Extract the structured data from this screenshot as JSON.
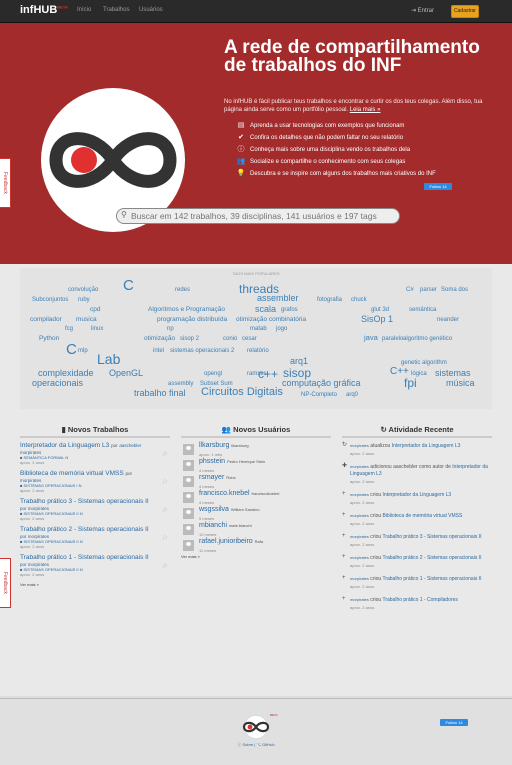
{
  "nav": {
    "brand": "infHUB",
    "brand_sup": "BETA",
    "links": [
      "Início",
      "Trabalhos",
      "Usuários"
    ],
    "login": "Entrar",
    "signup": "Cadastrar"
  },
  "hero": {
    "title": "A rede de compartilhamento de trabalhos do INF",
    "description": "No infHUB é fácil publicar teus trabalhos e encontrar e curtir os dos teus colegas. Além disso, tua página ainda serve como um portfólio pessoal.",
    "read_more": "Leia mais »",
    "features": [
      {
        "icon": "book-icon",
        "text": "Aprenda a usar tecnologias com exemplos que funcionam"
      },
      {
        "icon": "check-icon",
        "text": "Confira os detalhes que não podem faltar no seu relatório"
      },
      {
        "icon": "info-icon",
        "text": "Conheça mais sobre uma disciplina vendo os trabalhos dela"
      },
      {
        "icon": "users-icon",
        "text": "Socialize e compartilhe o conhecimento com seus colegas"
      },
      {
        "icon": "lightbulb-icon",
        "text": "Descubra e se inspire com alguns dos trabalhos mais criativos do INF"
      }
    ],
    "twitter": "Follow 14",
    "search_placeholder": "Buscar em 142 trabalhos, 39 disciplinas, 141 usuários e 197 tags"
  },
  "feedback": "Feedback",
  "tags_title": "TAGS MAIS POPULARES",
  "tags": [
    "C",
    "threads",
    "convolução",
    "redes",
    "C#",
    "parser",
    "Soma dos",
    "Subconjuntos",
    "ruby",
    "assembler",
    "fotografia",
    "chuck",
    "scala",
    "grafos",
    "SisOp 1",
    "glut 3d",
    "semântica",
    "compilador",
    "musica",
    "cpd",
    "Algoritmos e Programação",
    "programação distribuída",
    "otimização combinatória",
    "neander",
    "Python",
    "fcg",
    "linux",
    "np",
    "matab",
    "jogo",
    "otimização",
    "sisop 2",
    "conio",
    "cesar",
    "java",
    "paralelo",
    "algoritmo genético",
    "C",
    "Lab",
    "mlp",
    "intel",
    "sistemas operacionais 2",
    "relatório",
    "arq1",
    "C++",
    "genetic algorithm",
    "complexidade",
    "OpenGL",
    "opengl",
    "ramses",
    "c++",
    "sisop",
    "lógica",
    "sistemas",
    "operacionais",
    "assembly",
    "Subset Sum",
    "computação gráfica",
    "fpi",
    "música",
    "trabalho final",
    "Circuitos Digitais",
    "NP-Completo",
    "arq0"
  ],
  "columns": {
    "works_title": "Novos Trabalhos",
    "users_title": "Novos Usuários",
    "activity_title": "Atividade Recente",
    "by": "por",
    "works": [
      {
        "title": "Interpretador da Linguagem L3",
        "author": "aaschebler",
        "author2": "morpirates",
        "discipline": "SEMÂNTICA FORMAL N",
        "time": "aprox. 2 anos"
      },
      {
        "title": "Biblioteca de memória virtual VMSS",
        "author": "morpirates",
        "author2": "",
        "discipline": "SISTEMAS OPERACIONAIS I N",
        "time": "aprox. 2 anos"
      },
      {
        "title": "Trabalho prático 3 - Sistemas operacionais II",
        "author": "morpirates",
        "author2": "",
        "discipline": "SISTEMAS OPERACIONAIS II N",
        "time": "aprox. 2 anos"
      },
      {
        "title": "Trabalho prático 2 - Sistemas operacionais II",
        "author": "morpirates",
        "author2": "",
        "discipline": "SISTEMAS OPERACIONAIS II N",
        "time": "aprox. 2 anos"
      },
      {
        "title": "Trabalho prático 1 - Sistemas operacionais II",
        "author": "morpirates",
        "author2": "",
        "discipline": "SISTEMAS OPERACIONAIS II N",
        "time": "aprox. 2 anos"
      }
    ],
    "works_more": "Ver mais »",
    "users": [
      {
        "username": "llkarsburg",
        "name": "llkarsburg",
        "time": "aprox. 1 mês"
      },
      {
        "username": "phsstein",
        "name": "Pedro Henrique Stein",
        "time": "4 meses"
      },
      {
        "username": "rsmayer",
        "name": "Robs",
        "time": "4 meses"
      },
      {
        "username": "francisco.knebel",
        "name": "franciscoknebel",
        "time": "4 meses"
      },
      {
        "username": "wsgssilva",
        "name": "William Sandino",
        "time": "5 meses"
      },
      {
        "username": "mbianchi",
        "name": "mate.bianchi",
        "time": "10 meses"
      },
      {
        "username": "rafael.junioribeiro",
        "name": "Rafa",
        "time": "11 meses"
      }
    ],
    "users_more": "Ver mais »",
    "activity": [
      {
        "icon": "refresh-icon",
        "user": "morpirates",
        "text": "atualizou",
        "target": "Interpretador da Linguagem L3",
        "time": "aprox. 2 anos"
      },
      {
        "icon": "user-plus-icon",
        "user": "morpirates",
        "text": "adicionou aaschebler como autor de",
        "target": "Interpretador da Linguagem L3",
        "time": "aprox. 2 anos"
      },
      {
        "icon": "plus-icon",
        "user": "morpirates",
        "text": "criou",
        "target": "Interpretador da Linguagem L3",
        "time": "aprox. 2 anos"
      },
      {
        "icon": "plus-icon",
        "user": "morpirates",
        "text": "criou",
        "target": "Biblioteca de memória virtual VMSS",
        "time": "aprox. 2 anos"
      },
      {
        "icon": "plus-icon",
        "user": "morpirates",
        "text": "criou",
        "target": "Trabalho prático 3 - Sistemas operacionais II",
        "time": "aprox. 2 anos"
      },
      {
        "icon": "plus-icon",
        "user": "morpirates",
        "text": "criou",
        "target": "Trabalho prático 2 - Sistemas operacionais II",
        "time": "aprox. 2 anos"
      },
      {
        "icon": "plus-icon",
        "user": "morpirates",
        "text": "criou",
        "target": "Trabalho prático 1 - Sistemas operacionais II",
        "time": "aprox. 2 anos"
      },
      {
        "icon": "plus-icon",
        "user": "morpirates",
        "text": "criou",
        "target": "Trabalho prático 1 - Compiladores",
        "time": "aprox. 2 anos"
      }
    ]
  },
  "footer": {
    "beta": "BETA",
    "about": "Sobre",
    "github": "GitHub",
    "twitter": "Follow 14"
  },
  "colors": {
    "hero_bg": "#a32b2b",
    "accent": "#e8a21e",
    "link": "#2c6aa0",
    "tag": "#3d7fb4"
  }
}
